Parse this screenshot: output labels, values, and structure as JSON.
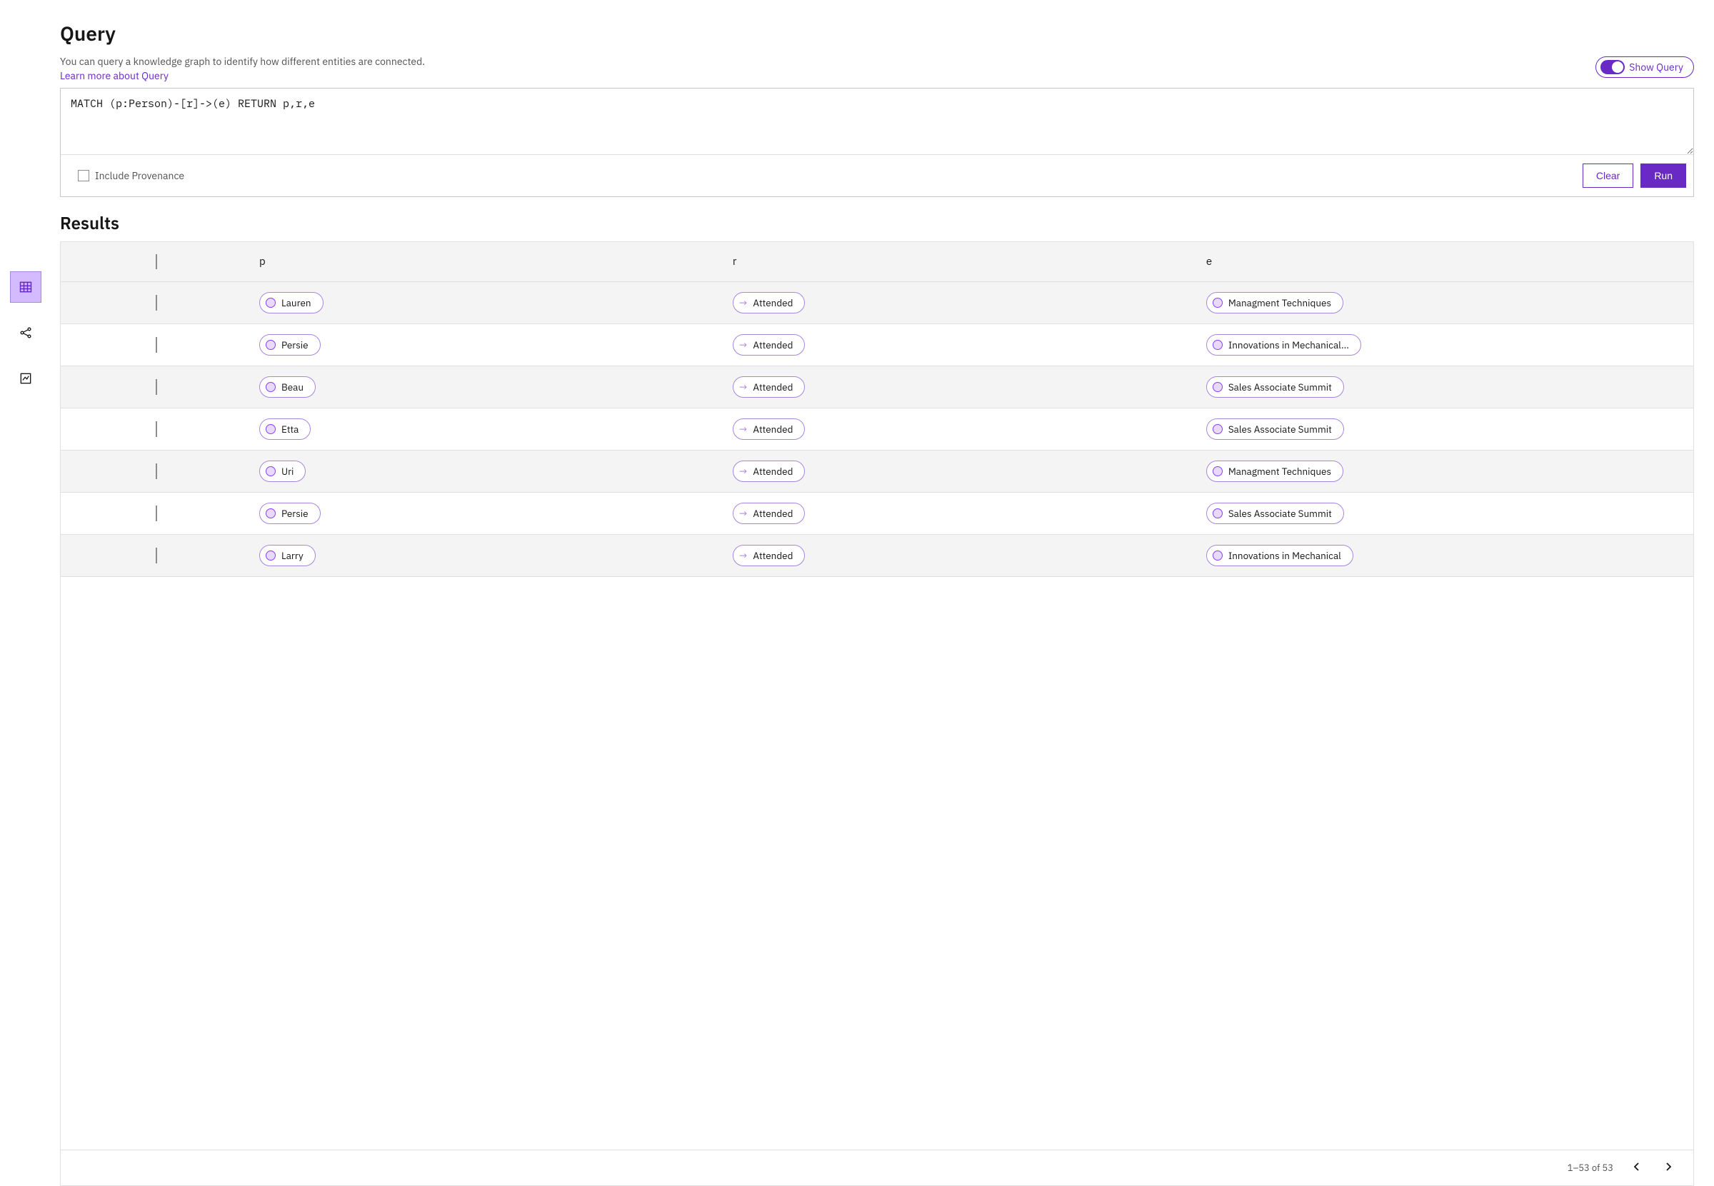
{
  "header": {
    "title": "Query",
    "description": "You can query a knowledge graph to identify how different entities are connected.",
    "learn_more": "Learn more about Query",
    "toggle_label": "Show Query"
  },
  "query": {
    "text": "MATCH (p:Person)-[r]->(e) RETURN p,r,e",
    "include_provenance_label": "Include Provenance",
    "clear_label": "Clear",
    "run_label": "Run"
  },
  "results": {
    "title": "Results",
    "columns": {
      "p": "p",
      "r": "r",
      "e": "e"
    },
    "rows": [
      {
        "p": "Lauren",
        "r": "Attended",
        "e": "Managment Techniques"
      },
      {
        "p": "Persie",
        "r": "Attended",
        "e": "Innovations in Mechanical..."
      },
      {
        "p": "Beau",
        "r": "Attended",
        "e": "Sales Associate Summit"
      },
      {
        "p": "Etta",
        "r": "Attended",
        "e": "Sales Associate Summit"
      },
      {
        "p": "Uri",
        "r": "Attended",
        "e": "Managment Techniques"
      },
      {
        "p": "Persie",
        "r": "Attended",
        "e": "Sales Associate Summit"
      },
      {
        "p": "Larry",
        "r": "Attended",
        "e": "Innovations in Mechanical"
      }
    ],
    "pager": "1–53 of 53"
  }
}
